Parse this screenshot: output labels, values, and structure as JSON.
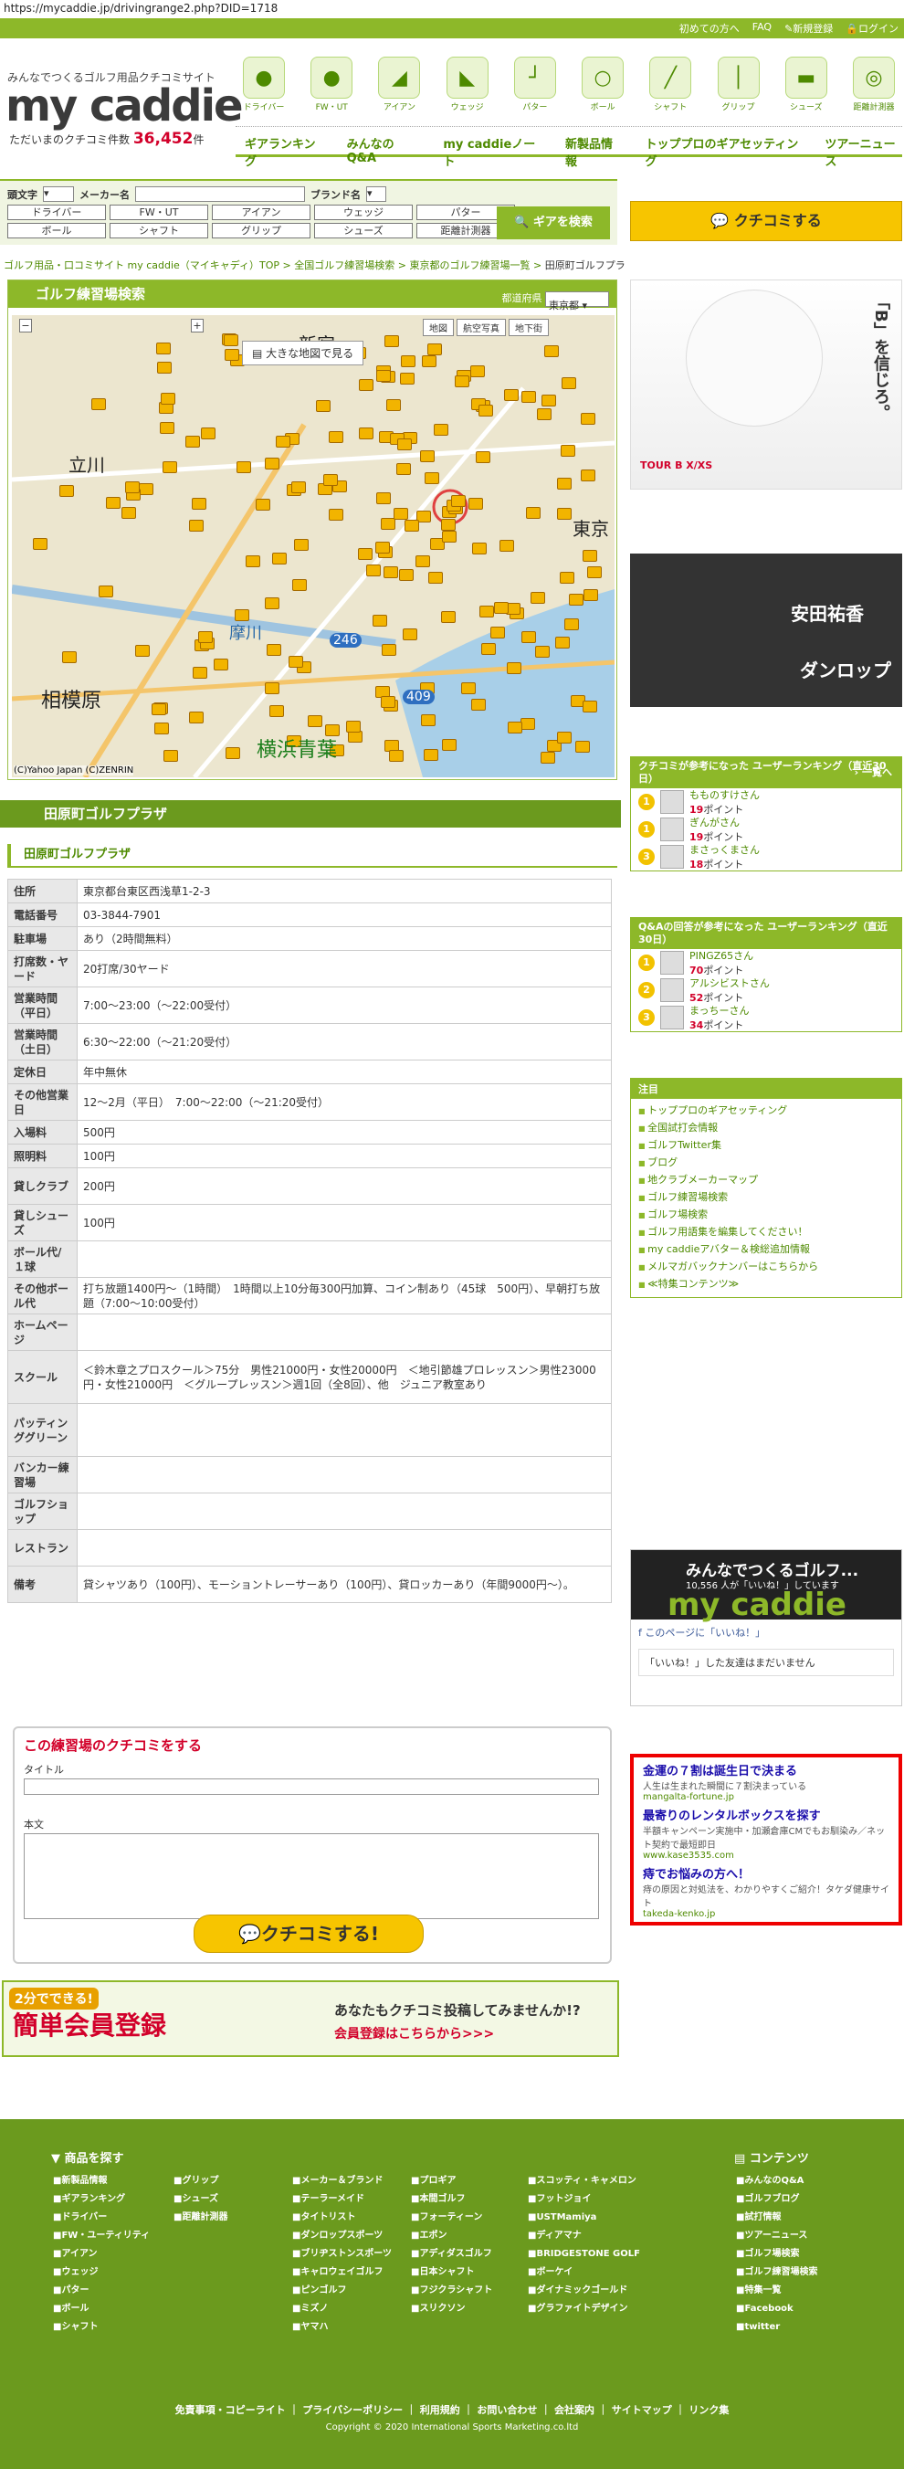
{
  "url": "https://mycaddie.jp/drivingrange2.php?DID=1718",
  "top_links": [
    "初めての方へ",
    "FAQ",
    "新規登録",
    "ログイン"
  ],
  "logo": {
    "tagline": "みんなでつくるゴルフ用品クチコミサイト",
    "name": "my caddie",
    "count_label": "ただいまのクチコミ件数",
    "count": "36,452",
    "count_unit": "件"
  },
  "categories": [
    "ドライバー",
    "FW・UT",
    "アイアン",
    "ウェッジ",
    "パター",
    "ボール",
    "シャフト",
    "グリップ",
    "シューズ",
    "距離計測器"
  ],
  "main_nav": [
    "ギアランキング",
    "みんなのQ&A",
    "my caddieノート",
    "新製品情報",
    "トッププロのギアセッティング",
    "ツアーニュース"
  ],
  "search": {
    "initial_label": "頭文字",
    "maker_label": "メーカー名",
    "brand_label": "ブランド名",
    "buttons": [
      "ドライバー",
      "FW・UT",
      "アイアン",
      "ウェッジ",
      "パター",
      "ボール",
      "シャフト",
      "グリップ",
      "シューズ",
      "距離計測器"
    ],
    "submit": "ギアを検索"
  },
  "kuchikomi_button": "クチコミする",
  "breadcrumb": [
    "ゴルフ用品・口コミサイト my caddie（マイキャディ）TOP",
    "全国ゴルフ練習場検索",
    "東京都のゴルフ練習場一覧",
    "田原町ゴルフプラザ"
  ],
  "map": {
    "title": "ゴルフ練習場検索",
    "pref_label": "都道府県",
    "pref_value": "東京都",
    "big_map": "大きな地図で見る",
    "type_buttons": [
      "地図",
      "航空写真",
      "地下街"
    ],
    "copyright": "(C)Yahoo Japan (C)ZENRIN",
    "labels": [
      "立川",
      "相模原",
      "横浜青葉",
      "新宿",
      "東京",
      "摩川",
      "246",
      "409"
    ]
  },
  "section_title": "田原町ゴルフプラザ",
  "sub_title": "田原町ゴルフプラザ",
  "info": [
    {
      "k": "住所",
      "v": "東京都台東区西浅草1-2-3"
    },
    {
      "k": "電話番号",
      "v": "03-3844-7901"
    },
    {
      "k": "駐車場",
      "v": "あり（2時間無料）"
    },
    {
      "k": "打席数・ヤード",
      "v": "20打席/30ヤード"
    },
    {
      "k": "営業時間（平日）",
      "v": "7:00～23:00（～22:00受付）"
    },
    {
      "k": "営業時間（土日）",
      "v": "6:30～22:00（～21:20受付）"
    },
    {
      "k": "定休日",
      "v": "年中無休"
    },
    {
      "k": "その他営業日",
      "v": "12～2月（平日）　7:00～22:00（～21:20受付）"
    },
    {
      "k": "入場料",
      "v": "500円"
    },
    {
      "k": "照明料",
      "v": "100円"
    },
    {
      "k": "貸しクラブ",
      "v": "200円"
    },
    {
      "k": "貸しシューズ",
      "v": "100円"
    },
    {
      "k": "ボール代/１球",
      "v": ""
    },
    {
      "k": "その他ボール代",
      "v": "打ち放題1400円～（1時間）　1時間以上10分毎300円加算、コイン制あり（45球　500円）、早朝打ち放題（7:00～10:00受付）"
    },
    {
      "k": "ホームページ",
      "v": ""
    },
    {
      "k": "スクール",
      "v": "＜鈴木章之プロスクール＞75分　男性21000円・女性20000円　＜地引節雄プロレッスン＞男性23000円・女性21000円　＜グループレッスン＞週1回（全8回）、他　ジュニア教室あり"
    },
    {
      "k": "パッティンググリーン",
      "v": ""
    },
    {
      "k": "バンカー練習場",
      "v": ""
    },
    {
      "k": "ゴルフショップ",
      "v": ""
    },
    {
      "k": "レストラン",
      "v": ""
    },
    {
      "k": "備考",
      "v": "貸シャツあり（100円）、モーショントレーサーあり（100円）、貸ロッカーあり（年間9000円～）。"
    }
  ],
  "review_form": {
    "title": "この練習場のクチコミをする",
    "title_label": "タイトル",
    "body_label": "本文",
    "submit": "クチコミする!"
  },
  "register": {
    "badge": "2分でできる!",
    "title": "簡単会員登録",
    "question": "あなたもクチコミ投稿してみませんか!?",
    "link": "会員登録はこちらから>>>"
  },
  "ads": {
    "banner1_text": "「B」を信じろ。",
    "banner1_model": "TOUR B X/XS",
    "banner2_name": "安田祐香",
    "banner2_brand": "ダンロップ"
  },
  "ranking1": {
    "title": "クチコミが参考になった ユーザーランキング（直近30日）",
    "more": "一覧へ",
    "items": [
      {
        "rank": "1",
        "name": "もものすけさん",
        "points": "19",
        "unit": "ポイント"
      },
      {
        "rank": "1",
        "name": "ぎんがさん",
        "points": "19",
        "unit": "ポイント"
      },
      {
        "rank": "3",
        "name": "まさっくまさん",
        "points": "18",
        "unit": "ポイント"
      }
    ]
  },
  "ranking2": {
    "title": "Q&Aの回答が参考になった ユーザーランキング（直近30日）",
    "items": [
      {
        "rank": "1",
        "name": "PINGZ65さん",
        "points": "70",
        "unit": "ポイント"
      },
      {
        "rank": "2",
        "name": "アルシビストさん",
        "points": "52",
        "unit": "ポイント"
      },
      {
        "rank": "3",
        "name": "まっちーさん",
        "points": "34",
        "unit": "ポイント"
      }
    ]
  },
  "notice": {
    "title": "注目",
    "items": [
      "トッププロのギアセッティング",
      "全国試打会情報",
      "ゴルフTwitter集",
      "ブログ",
      "地クラブメーカーマップ",
      "ゴルフ練習場検索",
      "ゴルフ場検索",
      "ゴルフ用語集を編集してください！",
      "my caddieアバター＆検総追加情報",
      "メルマガバックナンバーはこちらから",
      "≪特集コンテンツ≫"
    ]
  },
  "facebook": {
    "title": "みんなでつくるゴルフ...",
    "sub": "10,556 人が「いいね！」しています",
    "logo": "my caddie",
    "like": "このページに「いいね！」",
    "friends": "「いいね！」した友達はまだいません"
  },
  "text_ads": [
    {
      "title": "金運の７割は誕生日で決まる",
      "desc": "人生は生まれた瞬間に７割決まっている",
      "url": "mangalta-fortune.jp"
    },
    {
      "title": "最寄りのレンタルボックスを探す",
      "desc": "半額キャンペーン実施中・加瀬倉庫CMでもお馴染み／ネット契約で最短即日",
      "url": "www.kase3535.com"
    },
    {
      "title": "痔でお悩みの方へ！",
      "desc": "痔の原因と対処法を、わかりやすくご紹介！タケダ健康サイト",
      "url": "takeda-kenko.jp"
    }
  ],
  "footer": {
    "products_title": "商品を探す",
    "contents_title": "コンテンツ",
    "col1": [
      "新製品情報",
      "ギアランキング",
      "ドライバー",
      "FW・ユーティリティ",
      "アイアン",
      "ウェッジ",
      "パター",
      "ボール",
      "シャフト"
    ],
    "col2": [
      "グリップ",
      "シューズ",
      "距離計測器"
    ],
    "col3": [
      "メーカー＆ブランド",
      "テーラーメイド",
      "タイトリスト",
      "ダンロップスポーツ",
      "ブリヂストンスポーツ",
      "キャロウェイゴルフ",
      "ピンゴルフ",
      "ミズノ",
      "ヤマハ"
    ],
    "col4": [
      "プロギア",
      "本間ゴルフ",
      "フォーティーン",
      "エポン",
      "アディダスゴルフ",
      "日本シャフト",
      "フジクラシャフト",
      "スリクソン"
    ],
    "col5": [
      "スコッティ・キャメロン",
      "フットジョイ",
      "USTMamiya",
      "ディアマナ",
      "BRIDGESTONE GOLF",
      "ボーケイ",
      "ダイナミックゴールド",
      "グラファイトデザイン"
    ],
    "col6": [
      "みんなのQ&A",
      "ゴルフブログ",
      "試打情報",
      "ツアーニュース",
      "ゴルフ場検索",
      "ゴルフ練習場検索",
      "特集一覧",
      "Facebook",
      "twitter"
    ],
    "links": "免責事項・コピーライト ｜ プライバシーポリシー ｜ 利用規約 ｜ お問い合わせ ｜ 会社案内 ｜ サイトマップ ｜ リンク集",
    "copyright": "Copyright © 2020 International Sports Marketing.co.ltd"
  }
}
